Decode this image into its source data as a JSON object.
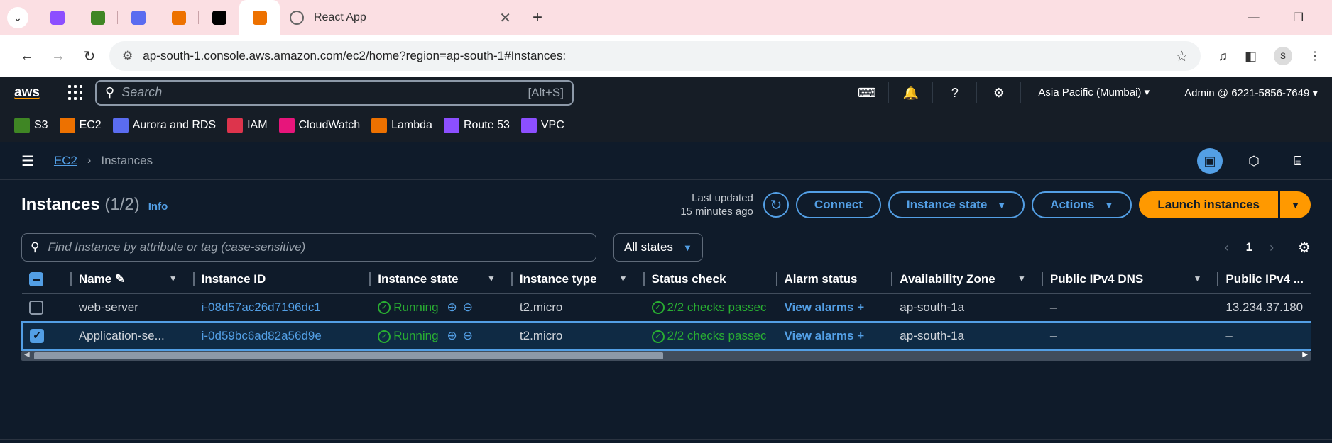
{
  "browser": {
    "tab_title": "React App",
    "url": "ap-south-1.console.aws.amazon.com/ec2/home?region=ap-south-1#Instances:",
    "profile_initial": "S",
    "pinned_tab_colors": [
      "#8c4fff",
      "#3f8624",
      "#5a6cf0",
      "#ed7100",
      "#000000",
      "#ed7100"
    ]
  },
  "aws_top": {
    "logo": "aws",
    "search_placeholder": "Search",
    "search_hint": "[Alt+S]",
    "region": "Asia Pacific (Mumbai)",
    "account": "Admin @ 6221-5856-7649"
  },
  "services": [
    {
      "label": "S3",
      "color": "#3f8624"
    },
    {
      "label": "EC2",
      "color": "#ed7100"
    },
    {
      "label": "Aurora and RDS",
      "color": "#5a6cf0"
    },
    {
      "label": "IAM",
      "color": "#dd344c"
    },
    {
      "label": "CloudWatch",
      "color": "#e7157b"
    },
    {
      "label": "Lambda",
      "color": "#ed7100"
    },
    {
      "label": "Route 53",
      "color": "#8c4fff"
    },
    {
      "label": "VPC",
      "color": "#8c4fff"
    }
  ],
  "breadcrumb": {
    "root": "EC2",
    "current": "Instances"
  },
  "header": {
    "title": "Instances",
    "count": "(1/2)",
    "info": "Info",
    "last_updated_line1": "Last updated",
    "last_updated_line2": "15 minutes ago",
    "connect": "Connect",
    "instance_state": "Instance state",
    "actions": "Actions",
    "launch": "Launch instances"
  },
  "filter": {
    "placeholder": "Find Instance by attribute or tag (case-sensitive)",
    "states": "All states",
    "page": "1"
  },
  "columns": [
    "Name",
    "Instance ID",
    "Instance state",
    "Instance type",
    "Status check",
    "Alarm status",
    "Availability Zone",
    "Public IPv4 DNS",
    "Public IPv4 ..."
  ],
  "rows": [
    {
      "name": "web-server",
      "id": "i-08d57ac26d7196dc1",
      "state": "Running",
      "type": "t2.micro",
      "status": "2/2 checks passec",
      "alarm": "View alarms",
      "az": "ap-south-1a",
      "dns": "–",
      "ip": "13.234.37.180",
      "selected": false
    },
    {
      "name": "Application-se...",
      "id": "i-0d59bc6ad82a56d9e",
      "state": "Running",
      "type": "t2.micro",
      "status": "2/2 checks passec",
      "alarm": "View alarms",
      "az": "ap-south-1a",
      "dns": "–",
      "ip": "–",
      "selected": true
    }
  ]
}
